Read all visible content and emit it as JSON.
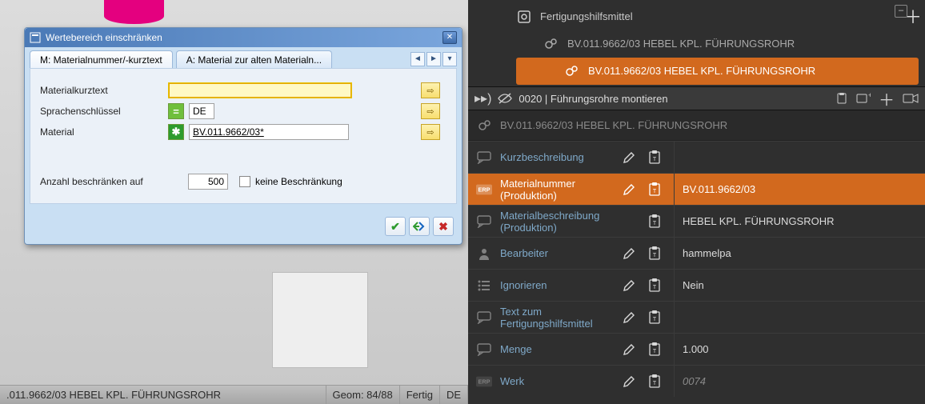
{
  "dialog": {
    "title": "Wertebereich einschränken",
    "tabs": {
      "active": "M: Materialnummer/-kurztext",
      "other": "A: Material zur alten Materialn..."
    },
    "fields": {
      "maktx_label": "Materialkurztext",
      "maktx_value": "",
      "spras_label": "Sprachenschlüssel",
      "spras_value": "DE",
      "matnr_label": "Material",
      "matnr_value": "BV.011.9662/03*"
    },
    "limit": {
      "label": "Anzahl beschränken auf",
      "value": "500",
      "no_limit_label": "keine Beschränkung"
    }
  },
  "sap_status": {
    "item": ".011.9662/03 HEBEL KPL. FÜHRUNGSROHR",
    "geom": "Geom: 84/88",
    "state": "Fertig",
    "lang": "DE"
  },
  "tree": {
    "root": "Fertigungshilfsmittel",
    "child1": "BV.011.9662/03 HEBEL KPL. FÜHRUNGSROHR",
    "child2": "BV.011.9662/03 HEBEL KPL. FÜHRUNGSROHR"
  },
  "step": {
    "text": "0020 | Führungsrohre montieren"
  },
  "header2": "BV.011.9662/03 HEBEL KPL. FÜHRUNGSROHR",
  "props": [
    {
      "icon": "chat",
      "label": "Kurzbeschreibung",
      "value": "",
      "edit": true,
      "paste": true
    },
    {
      "icon": "erp",
      "label": "Materialnummer\n(Produktion)",
      "value": "BV.011.9662/03",
      "edit": true,
      "paste": true,
      "selected": true
    },
    {
      "icon": "chat",
      "label": "Materialbeschreibung\n(Produktion)",
      "value": "HEBEL KPL. FÜHRUNGSROHR",
      "edit": false,
      "paste": true
    },
    {
      "icon": "person",
      "label": "Bearbeiter",
      "value": "hammelpa",
      "edit": true,
      "paste": true
    },
    {
      "icon": "list",
      "label": "Ignorieren",
      "value": "Nein",
      "edit": true,
      "paste": true
    },
    {
      "icon": "chat",
      "label": "Text zum\nFertigungshilfsmittel",
      "value": "",
      "edit": true,
      "paste": true
    },
    {
      "icon": "chat",
      "label": "Menge",
      "value": "1.000",
      "edit": true,
      "paste": true
    },
    {
      "icon": "erp",
      "label": "Werk",
      "value": "0074",
      "edit": true,
      "paste": true,
      "italic": true
    }
  ]
}
